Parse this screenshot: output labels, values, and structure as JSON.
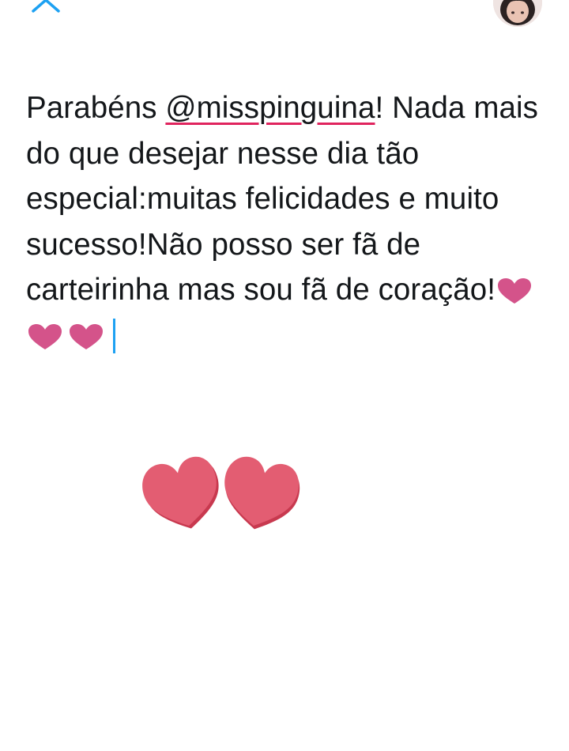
{
  "header": {
    "back_icon": "chevron-up-icon",
    "avatar_icon": "user-avatar"
  },
  "compose": {
    "text_before": "Parabéns ",
    "mention": "@misspinguina",
    "text_after": "! Nada mais do que desejar nesse dia tão especial:muitas felicidades e muito sucesso!Não posso ser fã de carteirinha mas sou fã de coração!",
    "emoji_hearts": [
      "❤",
      "❤",
      "❤"
    ]
  },
  "attachment": {
    "image_icon": "two-hearts-icon"
  },
  "colors": {
    "accent": "#1da1f2",
    "heart": "#e05f75",
    "emoji_heart": "#d4538a",
    "spellcheck": "#e0245e"
  }
}
